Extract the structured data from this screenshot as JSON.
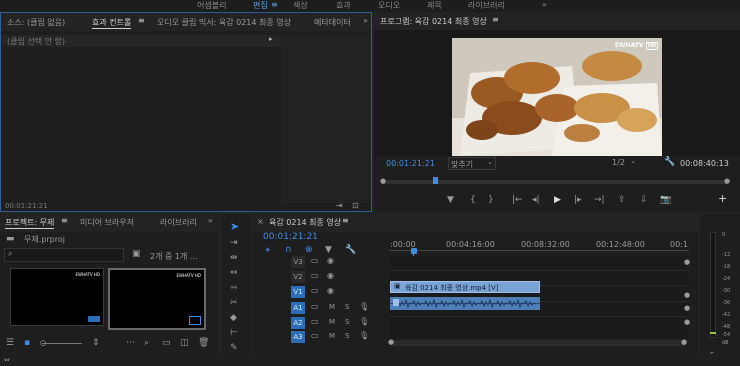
{
  "workspaces": [
    "어셈블리",
    "편집",
    "색상",
    "효과",
    "오디오",
    "제목",
    "라이브러리"
  ],
  "workspace_active": 1,
  "source_panel": {
    "tabs": [
      "소스: (클립 없음)",
      "효과 컨트롤",
      "오디오 클립 믹서: 육감 0214 최종 영상",
      "메타데이터"
    ],
    "no_clip": "(클립 선택 안 함)",
    "timecode": "00:01:21:21"
  },
  "program_panel": {
    "title": "프로그램: 육감 0214 최종 영상",
    "watermark": "EWHATV",
    "watermark_hd": "HD",
    "timecode": "00:01:21:21",
    "fit": "맞추기",
    "resolution": "1/2",
    "duration": "00:08:40:13"
  },
  "project_panel": {
    "tabs": [
      "프로젝트: 무제",
      "미디어 브라우저",
      "라이브러리"
    ],
    "file": "무제.prproj",
    "item_count": "2개 중 1개 ...",
    "search_placeholder": "",
    "thumb_logo": "EWHATV HD"
  },
  "timeline": {
    "title": "육감 0214 최종 영상",
    "timecode": "00:01:21:21",
    "ruler": [
      ":00:00",
      "00:04:16:00",
      "00:08:32:00",
      "00:12:48:00",
      "00:1"
    ],
    "video_tracks": [
      "V3",
      "V2",
      "V1"
    ],
    "audio_tracks": [
      "A1",
      "A2",
      "A3"
    ],
    "clip_label": "육감 0214 최종 영상.mp4 [V]",
    "m": "M",
    "s": "S"
  },
  "meter": {
    "scale": [
      "0",
      "-12",
      "-18",
      "-24",
      "-30",
      "-36",
      "-42",
      "-48",
      "-54",
      "dB"
    ]
  },
  "colors": {
    "accent": "#3d8fe6",
    "clip": "#7aa3d6",
    "audio_clip": "#4f7fb8"
  }
}
